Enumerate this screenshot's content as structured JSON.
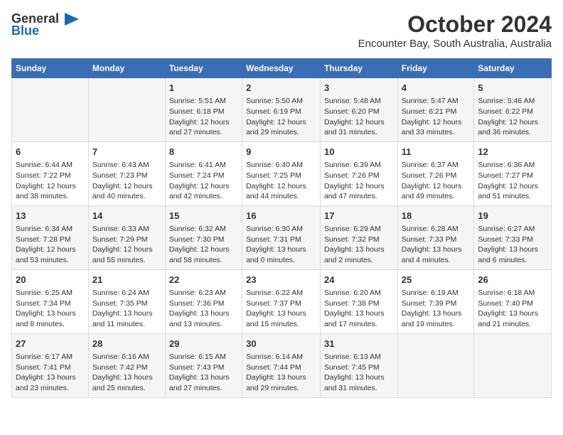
{
  "logo": {
    "line1": "General",
    "line2": "Blue",
    "arrow": "▶"
  },
  "title": "October 2024",
  "subtitle": "Encounter Bay, South Australia, Australia",
  "days_header": [
    "Sunday",
    "Monday",
    "Tuesday",
    "Wednesday",
    "Thursday",
    "Friday",
    "Saturday"
  ],
  "weeks": [
    [
      {
        "day": "",
        "content": ""
      },
      {
        "day": "",
        "content": ""
      },
      {
        "day": "1",
        "content": "Sunrise: 5:51 AM\nSunset: 6:18 PM\nDaylight: 12 hours\nand 27 minutes."
      },
      {
        "day": "2",
        "content": "Sunrise: 5:50 AM\nSunset: 6:19 PM\nDaylight: 12 hours\nand 29 minutes."
      },
      {
        "day": "3",
        "content": "Sunrise: 5:48 AM\nSunset: 6:20 PM\nDaylight: 12 hours\nand 31 minutes."
      },
      {
        "day": "4",
        "content": "Sunrise: 5:47 AM\nSunset: 6:21 PM\nDaylight: 12 hours\nand 33 minutes."
      },
      {
        "day": "5",
        "content": "Sunrise: 5:46 AM\nSunset: 6:22 PM\nDaylight: 12 hours\nand 36 minutes."
      }
    ],
    [
      {
        "day": "6",
        "content": "Sunrise: 6:44 AM\nSunset: 7:22 PM\nDaylight: 12 hours\nand 38 minutes."
      },
      {
        "day": "7",
        "content": "Sunrise: 6:43 AM\nSunset: 7:23 PM\nDaylight: 12 hours\nand 40 minutes."
      },
      {
        "day": "8",
        "content": "Sunrise: 6:41 AM\nSunset: 7:24 PM\nDaylight: 12 hours\nand 42 minutes."
      },
      {
        "day": "9",
        "content": "Sunrise: 6:40 AM\nSunset: 7:25 PM\nDaylight: 12 hours\nand 44 minutes."
      },
      {
        "day": "10",
        "content": "Sunrise: 6:39 AM\nSunset: 7:26 PM\nDaylight: 12 hours\nand 47 minutes."
      },
      {
        "day": "11",
        "content": "Sunrise: 6:37 AM\nSunset: 7:26 PM\nDaylight: 12 hours\nand 49 minutes."
      },
      {
        "day": "12",
        "content": "Sunrise: 6:36 AM\nSunset: 7:27 PM\nDaylight: 12 hours\nand 51 minutes."
      }
    ],
    [
      {
        "day": "13",
        "content": "Sunrise: 6:34 AM\nSunset: 7:28 PM\nDaylight: 12 hours\nand 53 minutes."
      },
      {
        "day": "14",
        "content": "Sunrise: 6:33 AM\nSunset: 7:29 PM\nDaylight: 12 hours\nand 55 minutes."
      },
      {
        "day": "15",
        "content": "Sunrise: 6:32 AM\nSunset: 7:30 PM\nDaylight: 12 hours\nand 58 minutes."
      },
      {
        "day": "16",
        "content": "Sunrise: 6:30 AM\nSunset: 7:31 PM\nDaylight: 13 hours\nand 0 minutes."
      },
      {
        "day": "17",
        "content": "Sunrise: 6:29 AM\nSunset: 7:32 PM\nDaylight: 13 hours\nand 2 minutes."
      },
      {
        "day": "18",
        "content": "Sunrise: 6:28 AM\nSunset: 7:33 PM\nDaylight: 13 hours\nand 4 minutes."
      },
      {
        "day": "19",
        "content": "Sunrise: 6:27 AM\nSunset: 7:33 PM\nDaylight: 13 hours\nand 6 minutes."
      }
    ],
    [
      {
        "day": "20",
        "content": "Sunrise: 6:25 AM\nSunset: 7:34 PM\nDaylight: 13 hours\nand 8 minutes."
      },
      {
        "day": "21",
        "content": "Sunrise: 6:24 AM\nSunset: 7:35 PM\nDaylight: 13 hours\nand 11 minutes."
      },
      {
        "day": "22",
        "content": "Sunrise: 6:23 AM\nSunset: 7:36 PM\nDaylight: 13 hours\nand 13 minutes."
      },
      {
        "day": "23",
        "content": "Sunrise: 6:22 AM\nSunset: 7:37 PM\nDaylight: 13 hours\nand 15 minutes."
      },
      {
        "day": "24",
        "content": "Sunrise: 6:20 AM\nSunset: 7:38 PM\nDaylight: 13 hours\nand 17 minutes."
      },
      {
        "day": "25",
        "content": "Sunrise: 6:19 AM\nSunset: 7:39 PM\nDaylight: 13 hours\nand 19 minutes."
      },
      {
        "day": "26",
        "content": "Sunrise: 6:18 AM\nSunset: 7:40 PM\nDaylight: 13 hours\nand 21 minutes."
      }
    ],
    [
      {
        "day": "27",
        "content": "Sunrise: 6:17 AM\nSunset: 7:41 PM\nDaylight: 13 hours\nand 23 minutes."
      },
      {
        "day": "28",
        "content": "Sunrise: 6:16 AM\nSunset: 7:42 PM\nDaylight: 13 hours\nand 25 minutes."
      },
      {
        "day": "29",
        "content": "Sunrise: 6:15 AM\nSunset: 7:43 PM\nDaylight: 13 hours\nand 27 minutes."
      },
      {
        "day": "30",
        "content": "Sunrise: 6:14 AM\nSunset: 7:44 PM\nDaylight: 13 hours\nand 29 minutes."
      },
      {
        "day": "31",
        "content": "Sunrise: 6:13 AM\nSunset: 7:45 PM\nDaylight: 13 hours\nand 31 minutes."
      },
      {
        "day": "",
        "content": ""
      },
      {
        "day": "",
        "content": ""
      }
    ]
  ]
}
